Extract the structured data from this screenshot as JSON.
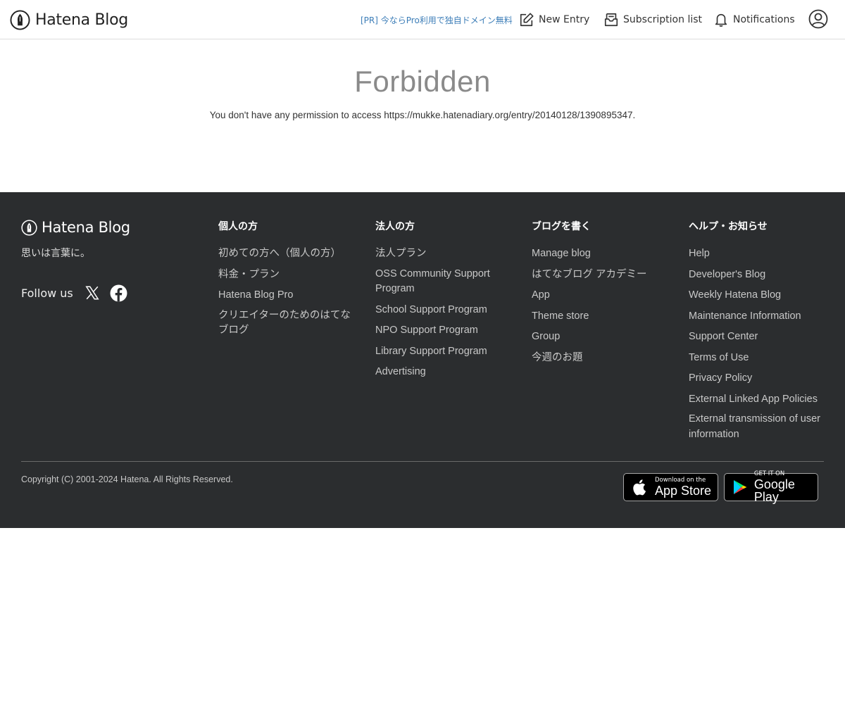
{
  "header": {
    "logo_text": "Hatena Blog",
    "pr_link": "[PR] 今ならPro利用で独自ドメイン無料",
    "nav": {
      "new_entry": "New Entry",
      "subscription_list": "Subscription list",
      "notifications": "Notifications"
    }
  },
  "main": {
    "title": "Forbidden",
    "message": "You don't have any permission to access https://mukke.hatenadiary.org/entry/20140128/1390895347."
  },
  "footer": {
    "logo_text": "Hatena Blog",
    "tagline": "思いは言葉に。",
    "follow_label": "Follow us",
    "columns": [
      {
        "heading": "個人の方",
        "links": [
          "初めての方へ（個人の方）",
          "料金・プラン",
          "Hatena Blog Pro",
          "クリエイターのためのはてなブログ"
        ]
      },
      {
        "heading": "法人の方",
        "links": [
          "法人プラン",
          "OSS Community Support Program",
          "School Support Program",
          "NPO Support Program",
          "Library Support Program",
          "Advertising"
        ]
      },
      {
        "heading": "ブログを書く",
        "links": [
          "Manage blog",
          "はてなブログ アカデミー",
          "App",
          "Theme store",
          "Group",
          "今週のお題"
        ]
      },
      {
        "heading": "ヘルプ・お知らせ",
        "links": [
          "Help",
          "Developer's Blog",
          "Weekly Hatena Blog",
          "Maintenance Information",
          "Support Center",
          "Terms of Use",
          "Privacy Policy",
          "External Linked App Policies",
          "External transmission of user information"
        ]
      }
    ],
    "copyright": "Copyright (C) 2001-2024 Hatena. All Rights Reserved.",
    "app_store": {
      "small": "Download on the",
      "big": "App Store"
    },
    "google_play": {
      "small": "GET IT ON",
      "big": "Google Play"
    }
  },
  "colors": {
    "footer_bg": "#2b2d2f",
    "pr_link": "#3d7eb8",
    "title_gray": "#8a8a8a"
  },
  "icons": [
    "hatena-logo-icon",
    "edit-icon",
    "subscription-icon",
    "bell-icon",
    "user-icon",
    "x-icon",
    "facebook-icon",
    "apple-icon",
    "google-play-icon"
  ]
}
